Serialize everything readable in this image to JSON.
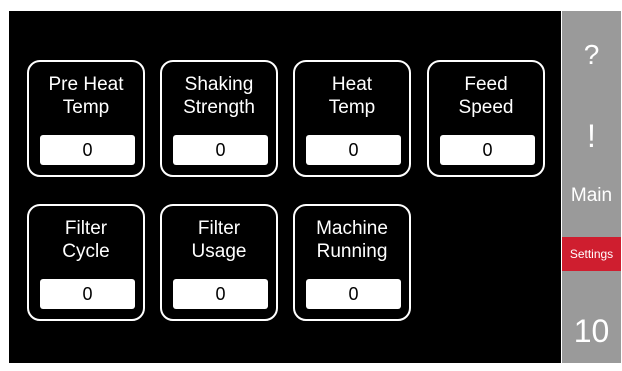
{
  "tiles": [
    {
      "line1": "Pre Heat",
      "line2": "Temp",
      "value": "0"
    },
    {
      "line1": "Shaking",
      "line2": "Strength",
      "value": "0"
    },
    {
      "line1": "Heat",
      "line2": "Temp",
      "value": "0"
    },
    {
      "line1": "Feed",
      "line2": "Speed",
      "value": "0"
    },
    {
      "line1": "Filter",
      "line2": "Cycle",
      "value": "0"
    },
    {
      "line1": "Filter",
      "line2": "Usage",
      "value": "0"
    },
    {
      "line1": "Machine",
      "line2": "Running",
      "value": "0"
    }
  ],
  "sidebar": {
    "help": "?",
    "alert": "!",
    "main": "Main",
    "settings": "Settings",
    "count": "10"
  },
  "colors": {
    "screen_bg": "#000000",
    "sidebar_bg": "#9a9a9a",
    "settings_active": "#cf1e2f",
    "text": "#ffffff"
  }
}
